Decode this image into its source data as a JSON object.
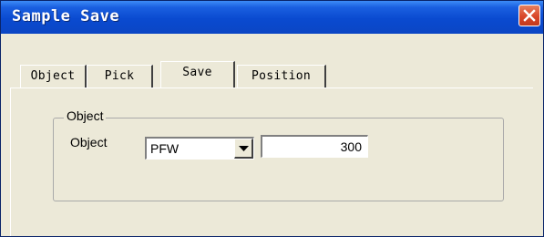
{
  "window": {
    "title": "Sample Save"
  },
  "tabs": [
    {
      "label": "Object"
    },
    {
      "label": "Pick"
    },
    {
      "label": "Save"
    },
    {
      "label": "Position"
    }
  ],
  "selected_tab": "Save",
  "group": {
    "legend": "Object",
    "field_label": "Object",
    "combo_value": "PFW",
    "number_value": "300"
  },
  "colors": {
    "titlebar": "#0a4ad0",
    "close": "#d9472a",
    "panel": "#ece9d8"
  },
  "icons": {
    "close": "close-x-icon",
    "dropdown": "triangle-down-icon"
  }
}
